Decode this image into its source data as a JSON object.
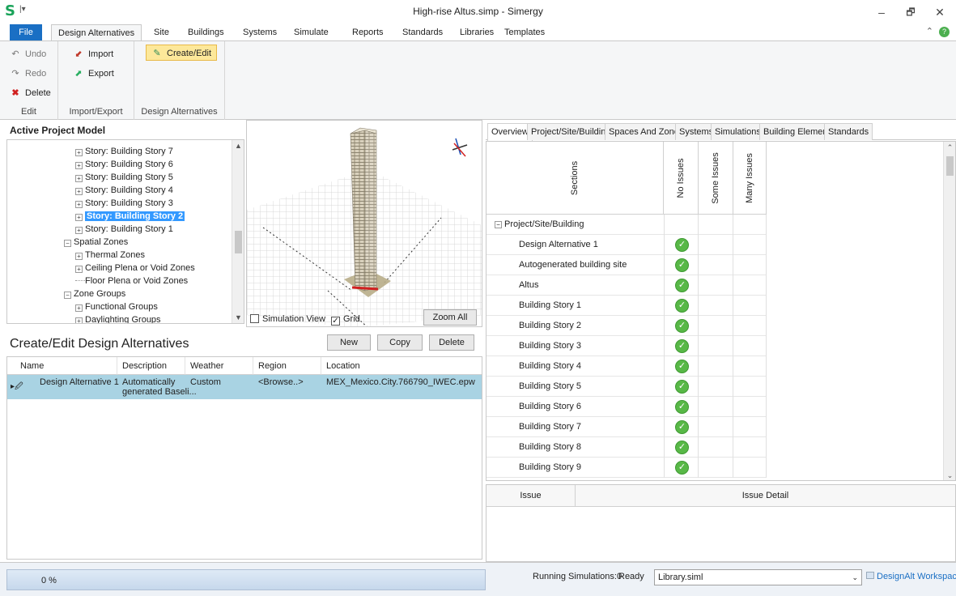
{
  "window": {
    "logo": "S",
    "qa": "|▾",
    "title": "High-rise Altus.simp - Simergy",
    "min": "–",
    "max": "🗗",
    "close": "✕"
  },
  "ribbon_tabs": [
    "File",
    "Design Alternatives",
    "Site",
    "Buildings",
    "Systems",
    "Simulate",
    "Reports",
    "Standards",
    "Libraries",
    "Templates"
  ],
  "ribbon_right": {
    "collapse": "⌃",
    "help": "?"
  },
  "ribbon": {
    "edit": {
      "undo": "Undo",
      "redo": "Redo",
      "delete": "Delete",
      "title": "Edit"
    },
    "import_export": {
      "import": "Import",
      "export": "Export",
      "title": "Import/Export"
    },
    "design_alternatives": {
      "create_edit": "Create/Edit",
      "title": "Design Alternatives"
    }
  },
  "project_model": {
    "title": "Active Project Model",
    "tree": [
      {
        "label": "Story: Building Story 7",
        "sign": "+",
        "indent": 4
      },
      {
        "label": "Story: Building Story 6",
        "sign": "+",
        "indent": 4
      },
      {
        "label": "Story: Building Story 5",
        "sign": "+",
        "indent": 4
      },
      {
        "label": "Story: Building Story 4",
        "sign": "+",
        "indent": 4
      },
      {
        "label": "Story: Building Story 3",
        "sign": "+",
        "indent": 4
      },
      {
        "label": "Story: Building Story 2",
        "sign": "+",
        "indent": 4,
        "selected": true
      },
      {
        "label": "Story: Building Story 1",
        "sign": "+",
        "indent": 4
      },
      {
        "label": "Spatial Zones",
        "sign": "−",
        "indent": 3
      },
      {
        "label": "Thermal Zones",
        "sign": "+",
        "indent": 4
      },
      {
        "label": "Ceiling Plena or Void Zones",
        "sign": "+",
        "indent": 4
      },
      {
        "label": "Floor Plena or Void Zones",
        "sign": "",
        "indent": 4
      },
      {
        "label": "Zone Groups",
        "sign": "−",
        "indent": 3
      },
      {
        "label": "Functional Groups",
        "sign": "+",
        "indent": 4
      },
      {
        "label": "Daylighting Groups",
        "sign": "+",
        "indent": 4
      }
    ]
  },
  "viewport": {
    "simulation_view": "Simulation View",
    "grid": "Grid",
    "grid_checked": true,
    "zoom_all": "Zoom All"
  },
  "design_alternatives": {
    "title": "Create/Edit Design Alternatives",
    "new": "New",
    "copy": "Copy",
    "delete": "Delete",
    "columns": [
      "Name",
      "Description",
      "Weather Source",
      "Region",
      "Location"
    ],
    "rows": [
      {
        "marker": "▸🖉",
        "name": "Design Alternative 1",
        "description_line1": "Automatically",
        "description_line2": "generated Baseli...",
        "weather": "Custom",
        "region": "<Browse..>",
        "location": "MEX_Mexico.City.766790_IWEC.epw"
      }
    ]
  },
  "overview_tabs": [
    "Overview",
    "Project/Site/Building",
    "Spaces And Zones",
    "Systems",
    "Simulations",
    "Building Elements",
    "Standards"
  ],
  "overview": {
    "col_sections": "Sections",
    "col_no": "No Issues",
    "col_some": "Some Issues",
    "col_many": "Many Issues",
    "group": "Project/Site/Building",
    "rows": [
      "Design Alternative 1",
      "Autogenerated building site",
      "Altus",
      "Building Story 1",
      "Building Story 2",
      "Building Story 3",
      "Building Story 4",
      "Building Story 5",
      "Building Story 6",
      "Building Story 7",
      "Building Story 8",
      "Building Story 9"
    ],
    "ok_glyph": "✓"
  },
  "issues": {
    "col_issue": "Issue",
    "col_detail": "Issue Detail"
  },
  "statusbar": {
    "progress_percent": 0,
    "progress_text": "0 %",
    "running": "Running Simulations:0",
    "ready": "Ready",
    "library": "Library.siml",
    "workspace": "DesignAlt Workspace"
  }
}
